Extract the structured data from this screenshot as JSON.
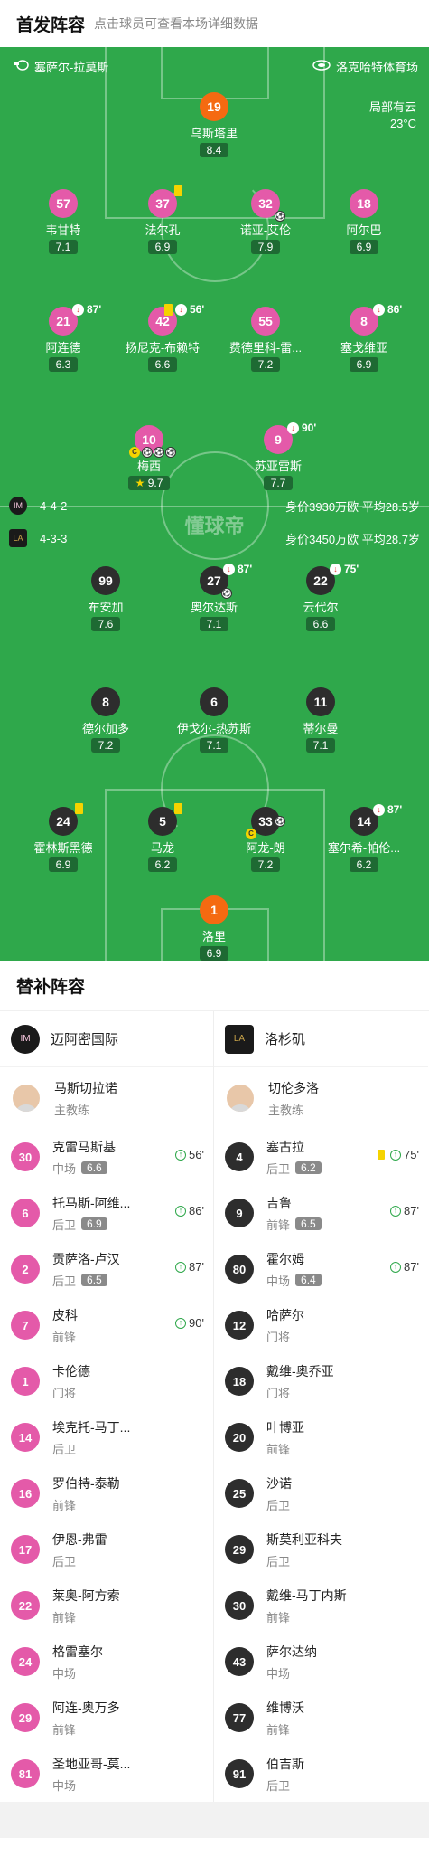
{
  "header": {
    "title": "首发阵容",
    "hint": "点击球员可查看本场详细数据"
  },
  "pitch": {
    "referee": "塞萨尔-拉莫斯",
    "stadium": "洛克哈特体育场",
    "weather": "局部有云",
    "temperature": "23°C",
    "watermark": "懂球帝"
  },
  "home": {
    "formation": "4-4-2",
    "summary": "身价3930万欧 平均28.5岁",
    "players": [
      {
        "num": "19",
        "name": "乌斯塔里",
        "rating": "8.4"
      },
      {
        "num": "57",
        "name": "韦甘特",
        "rating": "7.1"
      },
      {
        "num": "37",
        "name": "法尔孔",
        "rating": "6.9"
      },
      {
        "num": "32",
        "name": "诺亚-艾伦",
        "rating": "7.9"
      },
      {
        "num": "18",
        "name": "阿尔巴",
        "rating": "6.9"
      },
      {
        "num": "21",
        "name": "阿连德",
        "rating": "6.3",
        "sub": "87'"
      },
      {
        "num": "42",
        "name": "扬尼克-布赖特",
        "rating": "6.6",
        "sub": "56'"
      },
      {
        "num": "55",
        "name": "费德里科-雷...",
        "rating": "7.2"
      },
      {
        "num": "8",
        "name": "塞戈维亚",
        "rating": "6.9",
        "sub": "86'"
      },
      {
        "num": "10",
        "name": "梅西",
        "rating": "9.7"
      },
      {
        "num": "9",
        "name": "苏亚雷斯",
        "rating": "7.7",
        "sub": "90'"
      }
    ]
  },
  "away": {
    "formation": "4-3-3",
    "summary": "身价3450万欧 平均28.7岁",
    "players": [
      {
        "num": "99",
        "name": "布安加",
        "rating": "7.6"
      },
      {
        "num": "27",
        "name": "奥尔达斯",
        "rating": "7.1",
        "sub": "87'"
      },
      {
        "num": "22",
        "name": "云代尔",
        "rating": "6.6",
        "sub": "75'"
      },
      {
        "num": "8",
        "name": "德尔加多",
        "rating": "7.2"
      },
      {
        "num": "6",
        "name": "伊戈尔-热苏斯",
        "rating": "7.1"
      },
      {
        "num": "11",
        "name": "蒂尔曼",
        "rating": "7.1"
      },
      {
        "num": "24",
        "name": "霍林斯黑德",
        "rating": "6.9"
      },
      {
        "num": "5",
        "name": "马龙",
        "rating": "6.2"
      },
      {
        "num": "33",
        "name": "阿龙-朗",
        "rating": "7.2"
      },
      {
        "num": "14",
        "name": "塞尔希-帕伦...",
        "rating": "6.2",
        "sub": "87'"
      },
      {
        "num": "1",
        "name": "洛里",
        "rating": "6.9"
      }
    ]
  },
  "subs": {
    "title": "替补阵容",
    "home_team": "迈阿密国际",
    "away_team": "洛杉矶",
    "home_coach": {
      "name": "马斯切拉诺",
      "role": "主教练"
    },
    "away_coach": {
      "name": "切伦多洛",
      "role": "主教练"
    },
    "home": [
      {
        "num": "30",
        "name": "克雷马斯基",
        "pos": "中场",
        "rating": "6.6",
        "in": "56'"
      },
      {
        "num": "6",
        "name": "托马斯-阿维...",
        "pos": "后卫",
        "rating": "6.9",
        "in": "86'"
      },
      {
        "num": "2",
        "name": "贡萨洛-卢汉",
        "pos": "后卫",
        "rating": "6.5",
        "in": "87'"
      },
      {
        "num": "7",
        "name": "皮科",
        "pos": "前锋",
        "rating": "",
        "in": "90'"
      },
      {
        "num": "1",
        "name": "卡伦德",
        "pos": "门将",
        "rating": "",
        "in": ""
      },
      {
        "num": "14",
        "name": "埃克托-马丁...",
        "pos": "后卫",
        "rating": "",
        "in": ""
      },
      {
        "num": "16",
        "name": "罗伯特-泰勒",
        "pos": "前锋",
        "rating": "",
        "in": ""
      },
      {
        "num": "17",
        "name": "伊恩-弗雷",
        "pos": "后卫",
        "rating": "",
        "in": ""
      },
      {
        "num": "22",
        "name": "莱奥-阿方索",
        "pos": "前锋",
        "rating": "",
        "in": ""
      },
      {
        "num": "24",
        "name": "格雷塞尔",
        "pos": "中场",
        "rating": "",
        "in": ""
      },
      {
        "num": "29",
        "name": "阿连-奥万多",
        "pos": "前锋",
        "rating": "",
        "in": ""
      },
      {
        "num": "81",
        "name": "圣地亚哥-莫...",
        "pos": "中场",
        "rating": "",
        "in": ""
      }
    ],
    "away": [
      {
        "num": "4",
        "name": "塞古拉",
        "pos": "后卫",
        "rating": "6.2",
        "in": "75'",
        "yellow": true
      },
      {
        "num": "9",
        "name": "吉鲁",
        "pos": "前锋",
        "rating": "6.5",
        "in": "87'"
      },
      {
        "num": "80",
        "name": "霍尔姆",
        "pos": "中场",
        "rating": "6.4",
        "in": "87'"
      },
      {
        "num": "12",
        "name": "哈萨尔",
        "pos": "门将",
        "rating": "",
        "in": ""
      },
      {
        "num": "18",
        "name": "戴维-奥乔亚",
        "pos": "门将",
        "rating": "",
        "in": ""
      },
      {
        "num": "20",
        "name": "叶博亚",
        "pos": "前锋",
        "rating": "",
        "in": ""
      },
      {
        "num": "25",
        "name": "沙诺",
        "pos": "后卫",
        "rating": "",
        "in": ""
      },
      {
        "num": "29",
        "name": "斯莫利亚科夫",
        "pos": "后卫",
        "rating": "",
        "in": ""
      },
      {
        "num": "30",
        "name": "戴维-马丁内斯",
        "pos": "前锋",
        "rating": "",
        "in": ""
      },
      {
        "num": "43",
        "name": "萨尔达纳",
        "pos": "中场",
        "rating": "",
        "in": ""
      },
      {
        "num": "77",
        "name": "维博沃",
        "pos": "前锋",
        "rating": "",
        "in": ""
      },
      {
        "num": "91",
        "name": "伯吉斯",
        "pos": "后卫",
        "rating": "",
        "in": ""
      }
    ]
  },
  "colors": {
    "home": "#e45aa9",
    "away": "#2d2d2d",
    "keeper_home": "#f56a11",
    "pitch": "#2fa84b"
  }
}
